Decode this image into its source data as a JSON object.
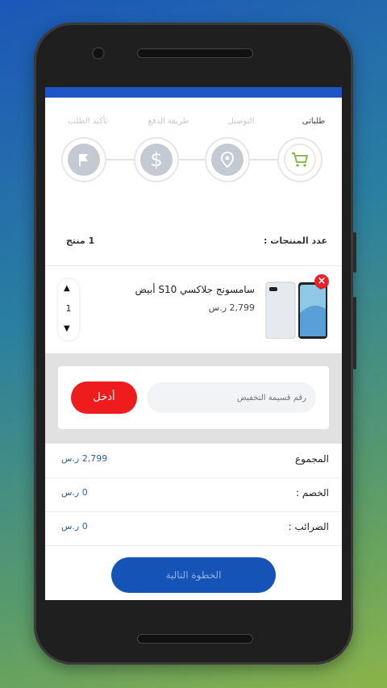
{
  "steps": [
    {
      "label": "طلباتى",
      "icon": "cart-icon",
      "active": true
    },
    {
      "label": "التوصيل",
      "icon": "location-pin-icon",
      "active": false
    },
    {
      "label": "طريقة الدفع",
      "icon": "dollar-icon",
      "active": false
    },
    {
      "label": "تأكيد الطلب",
      "icon": "flag-icon",
      "active": false
    }
  ],
  "products_count": {
    "label": "عدد المنتجات :",
    "value": "1 منتج"
  },
  "product": {
    "name": "سامسونج جلاكسي S10 أبيض",
    "price": "2,799 ر.س",
    "quantity": "1",
    "remove_icon": "×"
  },
  "coupon": {
    "placeholder": "رقم قسيمة التخفيض",
    "apply_label": "أدخل"
  },
  "totals": [
    {
      "label": "المجموع",
      "value": "2,799 ر.س"
    },
    {
      "label": "الخصم :",
      "value": "0 ر.س"
    },
    {
      "label": "الضرائب :",
      "value": "0 ر.س"
    }
  ],
  "next_button": "الخطوة التالية",
  "colors": {
    "accent": "#1f54c6",
    "danger": "#ee1c1c",
    "cart_green": "#7bb33a"
  }
}
